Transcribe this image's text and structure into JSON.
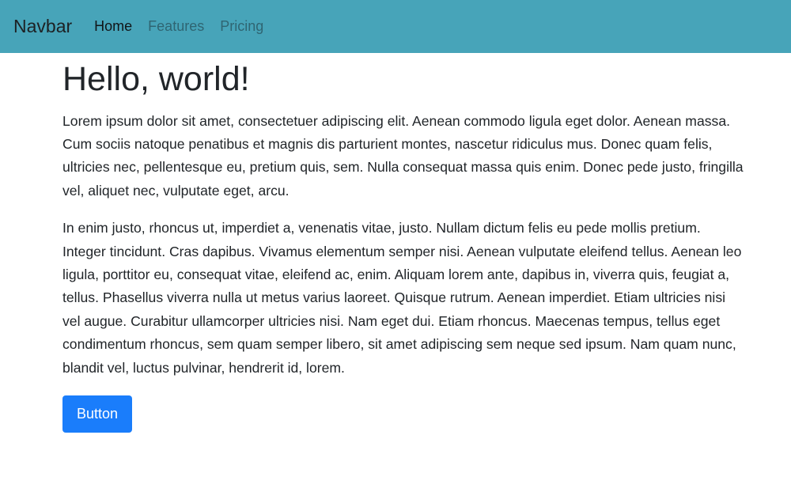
{
  "colors": {
    "navbar_bg": "#47a4b9",
    "button_bg": "#1a7dfb",
    "text": "#212529"
  },
  "navbar": {
    "brand": "Navbar",
    "links": [
      {
        "label": "Home",
        "active": true
      },
      {
        "label": "Features",
        "active": false
      },
      {
        "label": "Pricing",
        "active": false
      }
    ]
  },
  "main": {
    "heading": "Hello, world!",
    "paragraphs": [
      "Lorem ipsum dolor sit amet, consectetuer adipiscing elit. Aenean commodo ligula eget dolor. Aenean massa. Cum sociis natoque penatibus et magnis dis parturient montes, nascetur ridiculus mus. Donec quam felis, ultricies nec, pellentesque eu, pretium quis, sem. Nulla consequat massa quis enim. Donec pede justo, fringilla vel, aliquet nec, vulputate eget, arcu.",
      "In enim justo, rhoncus ut, imperdiet a, venenatis vitae, justo. Nullam dictum felis eu pede mollis pretium. Integer tincidunt. Cras dapibus. Vivamus elementum semper nisi. Aenean vulputate eleifend tellus. Aenean leo ligula, porttitor eu, consequat vitae, eleifend ac, enim. Aliquam lorem ante, dapibus in, viverra quis, feugiat a, tellus. Phasellus viverra nulla ut metus varius laoreet. Quisque rutrum. Aenean imperdiet. Etiam ultricies nisi vel augue. Curabitur ullamcorper ultricies nisi. Nam eget dui. Etiam rhoncus. Maecenas tempus, tellus eget condimentum rhoncus, sem quam semper libero, sit amet adipiscing sem neque sed ipsum. Nam quam nunc, blandit vel, luctus pulvinar, hendrerit id, lorem."
    ],
    "button_label": "Button"
  }
}
